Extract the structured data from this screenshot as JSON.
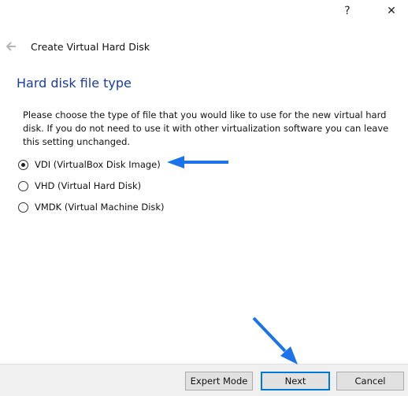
{
  "titlebar": {
    "help_label": "?",
    "close_label": "✕"
  },
  "header": {
    "back_icon": "arrow-left-icon",
    "title": "Create Virtual Hard Disk"
  },
  "page": {
    "heading": "Hard disk file type",
    "description": "Please choose the type of file that you would like to use for the new virtual hard disk. If you do not need to use it with other virtualization software you can leave this setting unchanged."
  },
  "options": [
    {
      "label": "VDI (VirtualBox Disk Image)",
      "selected": true
    },
    {
      "label": "VHD (Virtual Hard Disk)",
      "selected": false
    },
    {
      "label": "VMDK (Virtual Machine Disk)",
      "selected": false
    }
  ],
  "buttons": {
    "expert_mode": "Expert Mode",
    "next": "Next",
    "cancel": "Cancel"
  },
  "colors": {
    "heading": "#1a3d99",
    "annotation_arrow": "#1a73e8",
    "default_button_border": "#0078d7"
  }
}
